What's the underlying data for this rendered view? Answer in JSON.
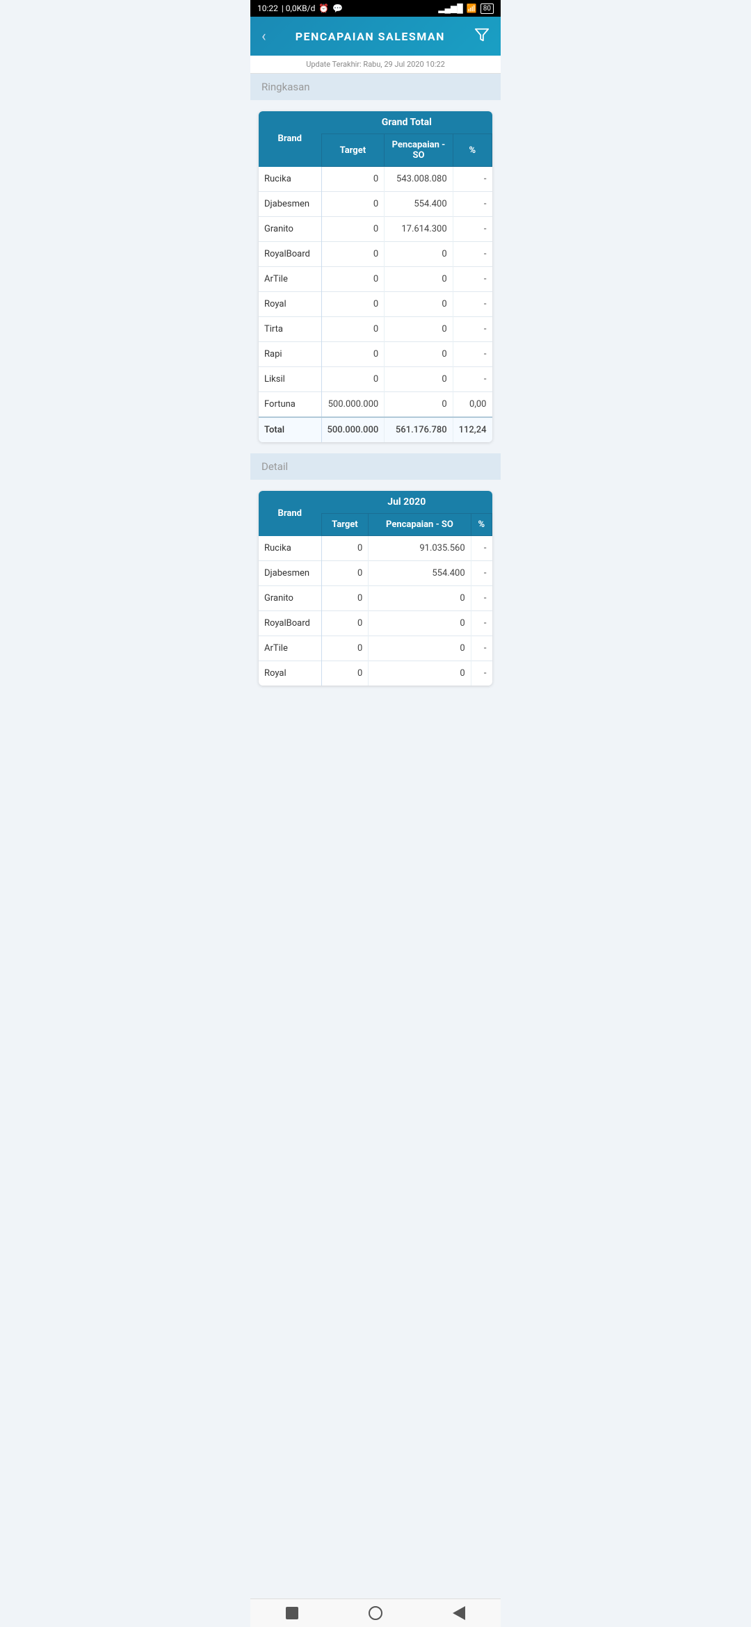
{
  "statusBar": {
    "time": "10:22",
    "network": "0,0KB/d",
    "battery": "80"
  },
  "header": {
    "title": "PENCAPAIAN SALESMAN",
    "backLabel": "‹",
    "filterLabel": "⛉"
  },
  "updateText": "Update Terakhir: Rabu, 29 Jul 2020 10:22",
  "sections": {
    "summary": {
      "label": "Ringkasan",
      "tableHeader": "Grand Total",
      "columns": [
        "Brand",
        "Target",
        "Pencapaian - SO",
        "%"
      ],
      "rows": [
        {
          "brand": "Rucika",
          "target": "0",
          "pencapaian": "543.008.080",
          "pct": "-"
        },
        {
          "brand": "Djabesmen",
          "target": "0",
          "pencapaian": "554.400",
          "pct": "-"
        },
        {
          "brand": "Granito",
          "target": "0",
          "pencapaian": "17.614.300",
          "pct": "-"
        },
        {
          "brand": "RoyalBoard",
          "target": "0",
          "pencapaian": "0",
          "pct": "-"
        },
        {
          "brand": "ArTile",
          "target": "0",
          "pencapaian": "0",
          "pct": "-"
        },
        {
          "brand": "Royal",
          "target": "0",
          "pencapaian": "0",
          "pct": "-"
        },
        {
          "brand": "Tirta",
          "target": "0",
          "pencapaian": "0",
          "pct": "-"
        },
        {
          "brand": "Rapi",
          "target": "0",
          "pencapaian": "0",
          "pct": "-"
        },
        {
          "brand": "Liksil",
          "target": "0",
          "pencapaian": "0",
          "pct": "-"
        },
        {
          "brand": "Fortuna",
          "target": "500.000.000",
          "pencapaian": "0",
          "pct": "0,00"
        }
      ],
      "totalRow": {
        "brand": "Total",
        "target": "500.000.000",
        "pencapaian": "561.176.780",
        "pct": "112,24"
      }
    },
    "detail": {
      "label": "Detail",
      "tableHeader": "Jul 2020",
      "columns": [
        "Brand",
        "Target",
        "Pencapaian - SO",
        "%"
      ],
      "rows": [
        {
          "brand": "Rucika",
          "target": "0",
          "pencapaian": "91.035.560",
          "pct": "-"
        },
        {
          "brand": "Djabesmen",
          "target": "0",
          "pencapaian": "554.400",
          "pct": "-"
        },
        {
          "brand": "Granito",
          "target": "0",
          "pencapaian": "0",
          "pct": "-"
        },
        {
          "brand": "RoyalBoard",
          "target": "0",
          "pencapaian": "0",
          "pct": "-"
        },
        {
          "brand": "ArTile",
          "target": "0",
          "pencapaian": "0",
          "pct": "-"
        },
        {
          "brand": "Royal",
          "target": "0",
          "pencapaian": "0",
          "pct": "-"
        }
      ]
    }
  },
  "navbar": {
    "items": [
      "square",
      "circle",
      "triangle"
    ]
  }
}
